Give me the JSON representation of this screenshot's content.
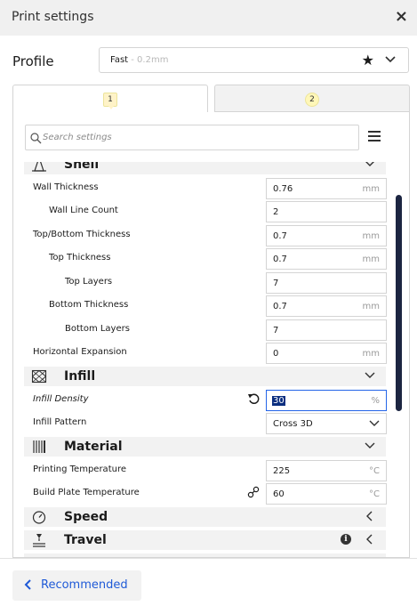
{
  "window": {
    "title": "Print settings",
    "close_icon": "×"
  },
  "profile": {
    "label": "Profile",
    "name": "Fast",
    "sub": " - 0.2mm"
  },
  "tabs": [
    {
      "badge": "1"
    },
    {
      "badge": "2"
    }
  ],
  "search": {
    "placeholder": "Search settings"
  },
  "categories": {
    "shell": "Shell",
    "infill": "Infill",
    "material": "Material",
    "speed": "Speed",
    "travel": "Travel"
  },
  "settings": {
    "wall_thickness": {
      "label": "Wall Thickness",
      "value": "0.76",
      "unit": "mm"
    },
    "wall_line_count": {
      "label": "Wall Line Count",
      "value": "2"
    },
    "top_bottom_thickness": {
      "label": "Top/Bottom Thickness",
      "value": "0.7",
      "unit": "mm"
    },
    "top_thickness": {
      "label": "Top Thickness",
      "value": "0.7",
      "unit": "mm"
    },
    "top_layers": {
      "label": "Top Layers",
      "value": "7"
    },
    "bottom_thickness": {
      "label": "Bottom Thickness",
      "value": "0.7",
      "unit": "mm"
    },
    "bottom_layers": {
      "label": "Bottom Layers",
      "value": "7"
    },
    "horizontal_expansion": {
      "label": "Horizontal Expansion",
      "value": "0",
      "unit": "mm"
    },
    "infill_density": {
      "label": "Infill Density",
      "value": "30",
      "unit": "%"
    },
    "infill_pattern": {
      "label": "Infill Pattern",
      "value": "Cross 3D"
    },
    "printing_temperature": {
      "label": "Printing Temperature",
      "value": "225",
      "unit": "°C"
    },
    "build_plate_temperature": {
      "label": "Build Plate Temperature",
      "value": "60",
      "unit": "°C"
    }
  },
  "footer": {
    "recommended_label": "Recommended"
  },
  "colors": {
    "accent": "#1f5ad7",
    "selection": "#0a2e7f",
    "scrollbar": "#1c2541"
  }
}
